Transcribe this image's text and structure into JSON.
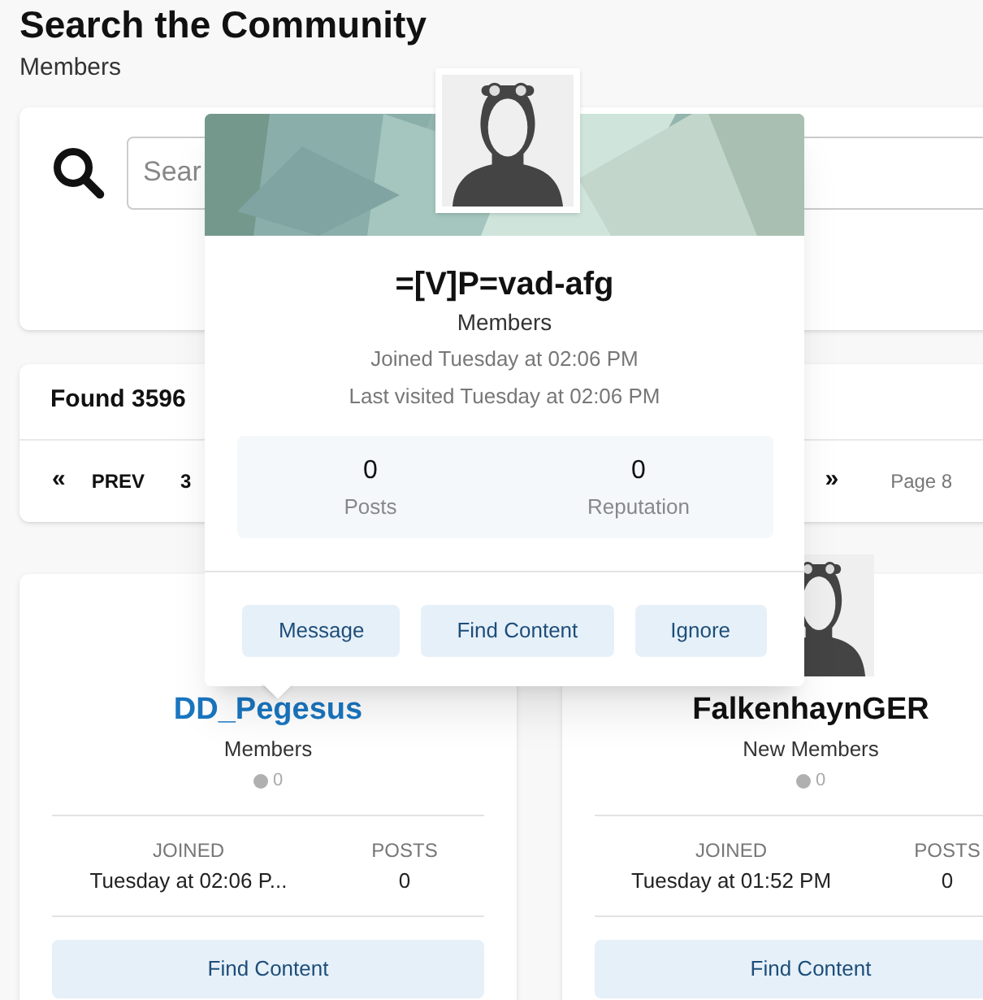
{
  "page": {
    "title": "Search the Community",
    "subtitle": "Members"
  },
  "search": {
    "placeholder": "Sear"
  },
  "results": {
    "heading": "Found 3596",
    "first": "«",
    "prev": "PREV",
    "pages": [
      "3"
    ],
    "next": "»",
    "page_info": "Page 8"
  },
  "members": [
    {
      "name": "DD_Pegesus",
      "highlighted": true,
      "group": "Members",
      "reputation": "0",
      "joined_label": "JOINED",
      "joined": "Tuesday at 02:06 P...",
      "posts_label": "POSTS",
      "posts": "0",
      "button": "Find Content",
      "avatar_visible": false
    },
    {
      "name": "FalkenhaynGER",
      "highlighted": false,
      "group": "New Members",
      "reputation": "0",
      "joined_label": "JOINED",
      "joined": "Tuesday at 01:52 PM",
      "posts_label": "POSTS",
      "posts": "0",
      "button": "Find Content",
      "avatar_visible": true
    }
  ],
  "popover": {
    "name": "=[V]P=vad-afg",
    "group": "Members",
    "joined": "Joined Tuesday at 02:06 PM",
    "last_visited": "Last visited Tuesday at 02:06 PM",
    "stats": [
      {
        "value": "0",
        "label": "Posts"
      },
      {
        "value": "0",
        "label": "Reputation"
      }
    ],
    "buttons": [
      "Message",
      "Find Content",
      "Ignore"
    ]
  }
}
